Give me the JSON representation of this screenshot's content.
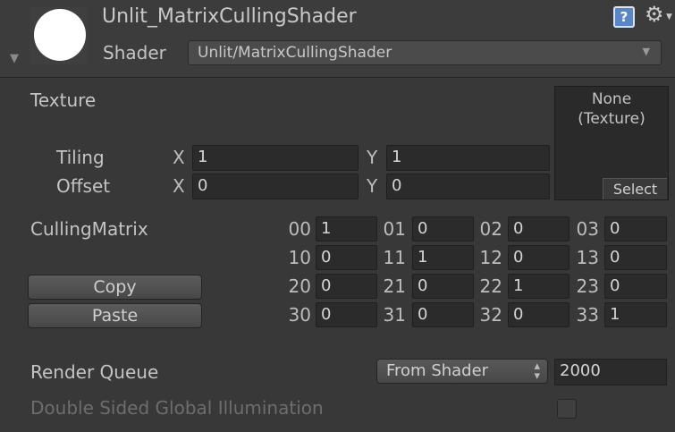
{
  "header": {
    "material_name": "Unlit_MatrixCullingShader",
    "shader_label": "Shader",
    "shader_value": "Unlit/MatrixCullingShader",
    "help_icon_glyph": "?",
    "gear_icon_glyph": "⚙",
    "fold_arrow_glyph": "▼",
    "dropdown_arrow_glyph": "▼"
  },
  "texture": {
    "label": "Texture",
    "slot_text_line1": "None",
    "slot_text_line2": "(Texture)",
    "select_label": "Select",
    "tiling_label": "Tiling",
    "offset_label": "Offset",
    "x_label": "X",
    "y_label": "Y",
    "tiling_x": "1",
    "tiling_y": "1",
    "offset_x": "0",
    "offset_y": "0"
  },
  "matrix": {
    "label": "CullingMatrix",
    "copy_label": "Copy",
    "paste_label": "Paste",
    "rows": [
      [
        {
          "label": "00",
          "value": "1"
        },
        {
          "label": "01",
          "value": "0"
        },
        {
          "label": "02",
          "value": "0"
        },
        {
          "label": "03",
          "value": "0"
        }
      ],
      [
        {
          "label": "10",
          "value": "0"
        },
        {
          "label": "11",
          "value": "1"
        },
        {
          "label": "12",
          "value": "0"
        },
        {
          "label": "13",
          "value": "0"
        }
      ],
      [
        {
          "label": "20",
          "value": "0"
        },
        {
          "label": "21",
          "value": "0"
        },
        {
          "label": "22",
          "value": "1"
        },
        {
          "label": "23",
          "value": "0"
        }
      ],
      [
        {
          "label": "30",
          "value": "0"
        },
        {
          "label": "31",
          "value": "0"
        },
        {
          "label": "32",
          "value": "0"
        },
        {
          "label": "33",
          "value": "1"
        }
      ]
    ]
  },
  "render_queue": {
    "label": "Render Queue",
    "mode": "From Shader",
    "value": "2000",
    "arrow_glyph": "▲▼"
  },
  "gi": {
    "label": "Double Sided Global Illumination",
    "checked": false
  },
  "colors": {
    "background": "#383838",
    "header_background": "#3c3c3c",
    "field_background": "#2b2b2b",
    "help_icon": "#5a86c6",
    "disabled_text": "#6d6d6d"
  }
}
